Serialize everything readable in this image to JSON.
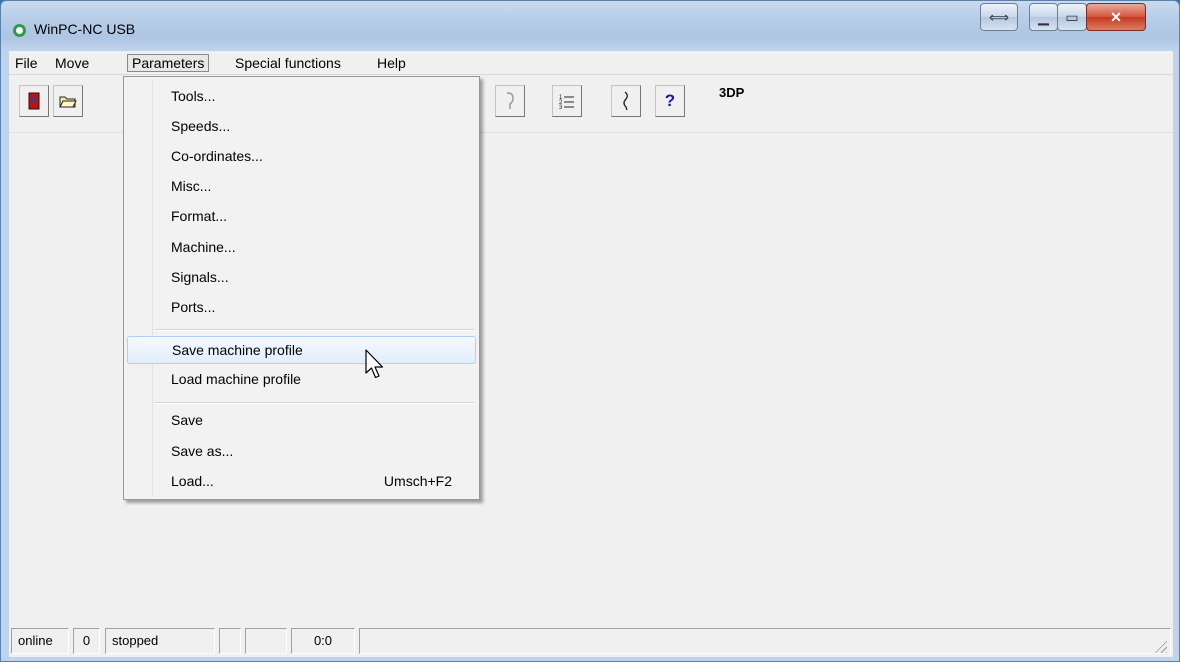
{
  "window": {
    "title": "WinPC-NC USB",
    "accent_color": "#2e9a4a",
    "caption_buttons": [
      "restore-arrows-icon",
      "minimize-icon",
      "maximize-icon",
      "close-icon"
    ]
  },
  "menubar": {
    "items": [
      "File",
      "Move",
      "Parameters",
      "Special functions",
      "Help"
    ],
    "active": "Parameters"
  },
  "toolbar": {
    "label": "3DP",
    "icons": [
      "exit-door-icon",
      "open-folder-icon",
      "probe-icon",
      "list-icon",
      "pen-icon",
      "help-icon"
    ],
    "help_glyph": "?"
  },
  "dropdown": {
    "items": [
      {
        "label": "Tools..."
      },
      {
        "label": "Speeds..."
      },
      {
        "label": "Co-ordinates..."
      },
      {
        "label": "Misc..."
      },
      {
        "label": "Format..."
      },
      {
        "label": "Machine..."
      },
      {
        "label": "Signals..."
      },
      {
        "label": "Ports..."
      },
      {
        "label": "Save machine profile"
      },
      {
        "label": "Load machine profile"
      },
      {
        "label": "Save"
      },
      {
        "label": "Save as..."
      },
      {
        "label": "Load...",
        "shortcut": "Umsch+F2"
      }
    ],
    "highlighted": "Save machine profile"
  },
  "statusbar": {
    "cells": [
      "online",
      "0",
      "stopped",
      "",
      "",
      "0:0",
      ""
    ]
  }
}
